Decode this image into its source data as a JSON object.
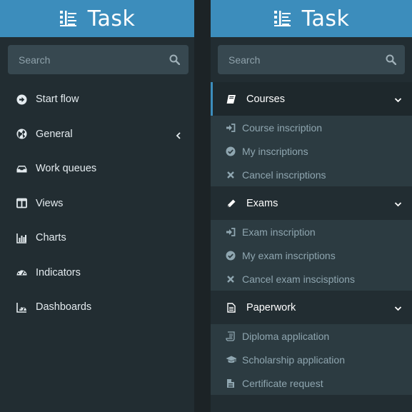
{
  "colors": {
    "brand": "#3c8dbc",
    "sidebar_bg": "#222d32",
    "submenu_bg": "#2c3b41",
    "text": "#e4ebef",
    "muted_text": "#8fa6b0"
  },
  "left": {
    "brand": {
      "title": "Task",
      "icon": "list-icon"
    },
    "search": {
      "placeholder": "Search",
      "icon": "search-icon"
    },
    "menu": [
      {
        "label": "Start flow",
        "icon": "arrow-circle-right-icon"
      },
      {
        "label": "General",
        "icon": "globe-icon",
        "expandable": true,
        "chevron": "chevron-left-icon"
      },
      {
        "label": "Work queues",
        "icon": "inbox-icon"
      },
      {
        "label": "Views",
        "icon": "columns-icon"
      },
      {
        "label": "Charts",
        "icon": "bar-chart-icon"
      },
      {
        "label": "Indicators",
        "icon": "dashboard-gauge-icon"
      },
      {
        "label": "Dashboards",
        "icon": "dashboard-chart-icon"
      }
    ]
  },
  "right": {
    "brand": {
      "title": "Task",
      "icon": "list-icon"
    },
    "search": {
      "placeholder": "Search",
      "icon": "search-icon"
    },
    "groups": [
      {
        "label": "Courses",
        "icon": "book-icon",
        "active": true,
        "chevron": "chevron-down-icon",
        "items": [
          {
            "label": "Course inscription",
            "icon": "sign-in-icon"
          },
          {
            "label": "My inscriptions",
            "icon": "check-circle-icon"
          },
          {
            "label": "Cancel inscriptions",
            "icon": "times-icon"
          }
        ]
      },
      {
        "label": "Exams",
        "icon": "pencil-icon",
        "active": false,
        "chevron": "chevron-down-icon",
        "items": [
          {
            "label": "Exam inscription",
            "icon": "sign-in-icon"
          },
          {
            "label": "My exam inscriptions",
            "icon": "check-circle-icon"
          },
          {
            "label": "Cancel exam inscisptions",
            "icon": "times-icon"
          }
        ]
      },
      {
        "label": "Paperwork",
        "icon": "file-text-icon",
        "active": false,
        "chevron": "chevron-down-icon",
        "items": [
          {
            "label": "Diploma application",
            "icon": "scroll-icon"
          },
          {
            "label": "Scholarship application",
            "icon": "graduation-cap-icon"
          },
          {
            "label": "Certificate request",
            "icon": "file-icon"
          }
        ]
      }
    ]
  }
}
